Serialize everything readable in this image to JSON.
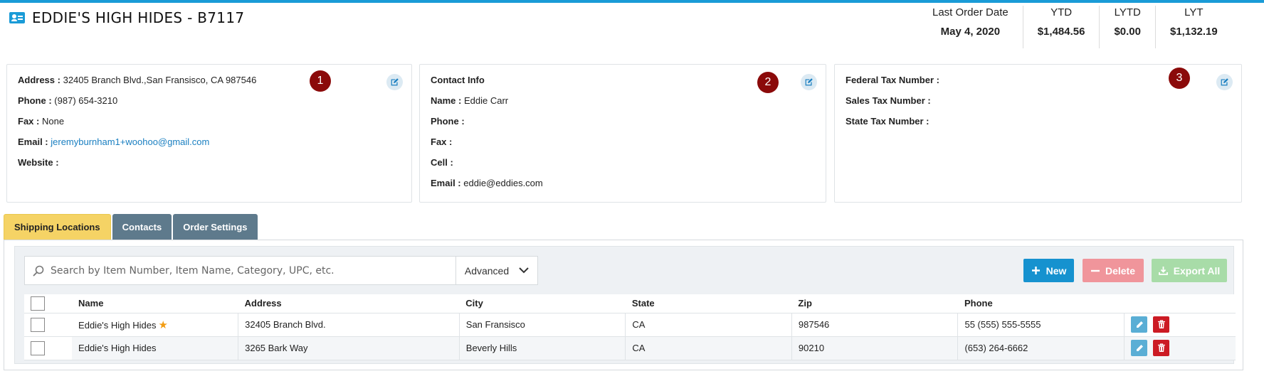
{
  "header": {
    "title": "EDDIE'S HIGH HIDES - B7117",
    "stats": [
      {
        "label": "Last Order Date",
        "value": "May 4, 2020"
      },
      {
        "label": "YTD",
        "value": "$1,484.56"
      },
      {
        "label": "LYTD",
        "value": "$0.00"
      },
      {
        "label": "LYT",
        "value": "$1,132.19"
      }
    ]
  },
  "cards": {
    "address": {
      "marker": "1",
      "address_label": "Address :",
      "address_value": "32405 Branch Blvd.,San Fransisco, CA 987546",
      "phone_label": "Phone :",
      "phone_value": "(987) 654-3210",
      "fax_label": "Fax :",
      "fax_value": "None",
      "email_label": "Email :",
      "email_value": "jeremyburnham1+woohoo@gmail.com",
      "website_label": "Website :",
      "website_value": ""
    },
    "contact": {
      "marker": "2",
      "heading": "Contact Info",
      "name_label": "Name :",
      "name_value": "Eddie Carr",
      "phone_label": "Phone :",
      "fax_label": "Fax :",
      "cell_label": "Cell :",
      "email_label": "Email :",
      "email_value": "eddie@eddies.com"
    },
    "tax": {
      "marker": "3",
      "federal_label": "Federal Tax Number :",
      "sales_label": "Sales Tax Number :",
      "state_label": "State Tax Number :"
    }
  },
  "tabs": [
    {
      "label": "Shipping Locations",
      "active": true
    },
    {
      "label": "Contacts",
      "active": false
    },
    {
      "label": "Order Settings",
      "active": false
    }
  ],
  "toolbar": {
    "search_placeholder": "Search by Item Number, Item Name, Category, UPC, etc.",
    "advanced_label": "Advanced",
    "new_label": "New",
    "delete_label": "Delete",
    "export_label": "Export All"
  },
  "table": {
    "columns": [
      "Name",
      "Address",
      "City",
      "State",
      "Zip",
      "Phone"
    ],
    "rows": [
      {
        "name": "Eddie's High Hides",
        "address": "32405 Branch Blvd.",
        "city": "San Fransisco",
        "state": "CA",
        "zip": "987546",
        "phone": "55 (555) 555-5555",
        "primary": true
      },
      {
        "name": "Eddie's High Hides",
        "address": "3265 Bark Way",
        "city": "Beverly Hills",
        "state": "CA",
        "zip": "90210",
        "phone": "(653) 264-6662",
        "primary": false
      }
    ]
  },
  "colors": {
    "accent": "#1a9bd7",
    "tab_active": "#f5d365",
    "tab_inactive": "#5e7a8c",
    "marker": "#8b0a0a",
    "delete_button": "#f0959b",
    "export_button": "#a8dca8"
  }
}
